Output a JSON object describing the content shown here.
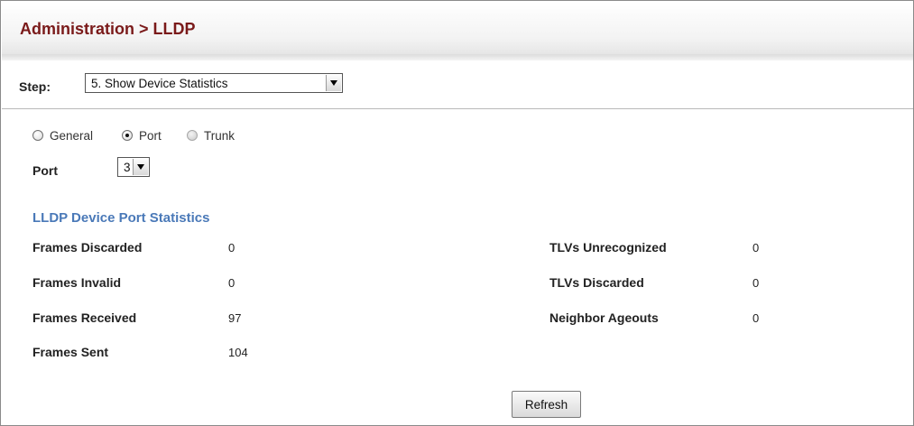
{
  "header": {
    "title": "Administration > LLDP"
  },
  "step": {
    "label": "Step:",
    "selected": "5. Show Device Statistics"
  },
  "scope_options": [
    {
      "label": "General",
      "checked": false,
      "disabled": false
    },
    {
      "label": "Port",
      "checked": true,
      "disabled": false
    },
    {
      "label": "Trunk",
      "checked": false,
      "disabled": true
    }
  ],
  "port": {
    "label": "Port",
    "selected": "3"
  },
  "section": {
    "title": "LLDP Device Port Statistics"
  },
  "stats_left": [
    {
      "label": "Frames Discarded",
      "value": "0"
    },
    {
      "label": "Frames Invalid",
      "value": "0"
    },
    {
      "label": "Frames Received",
      "value": "97"
    },
    {
      "label": "Frames Sent",
      "value": "104"
    }
  ],
  "stats_right": [
    {
      "label": "TLVs Unrecognized",
      "value": "0"
    },
    {
      "label": "TLVs Discarded",
      "value": "0"
    },
    {
      "label": "Neighbor Ageouts",
      "value": "0"
    }
  ],
  "actions": {
    "refresh_label": "Refresh"
  }
}
